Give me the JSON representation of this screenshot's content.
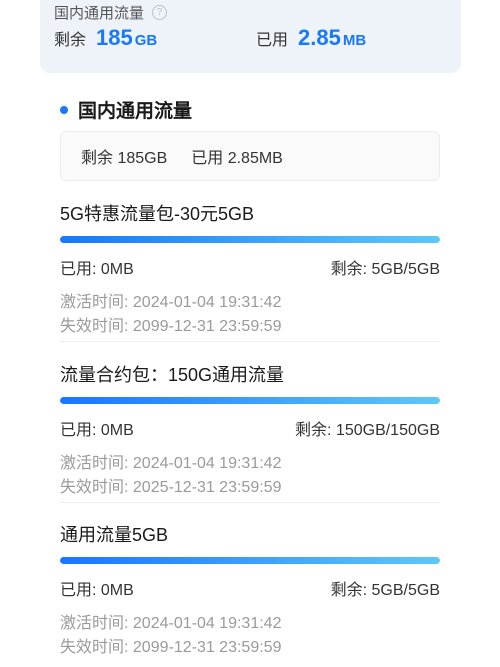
{
  "top_card": {
    "title": "国内通用流量",
    "help_symbol": "?",
    "remaining_label": "剩余",
    "remaining_value": "185",
    "remaining_unit": "GB",
    "used_label": "已用",
    "used_value": "2.85",
    "used_unit": "MB"
  },
  "section": {
    "title": "国内通用流量",
    "summary_remaining": "剩余 185GB",
    "summary_used": "已用 2.85MB"
  },
  "packages": [
    {
      "name": "5G特惠流量包-30元5GB",
      "progress": 1.0,
      "used": "已用: 0MB",
      "remaining": "剩余: 5GB/5GB",
      "activated": "激活时间: 2024-01-04 19:31:42",
      "expires": "失效时间: 2099-12-31 23:59:59"
    },
    {
      "name": "流量合约包：150G通用流量",
      "progress": 1.0,
      "used": "已用: 0MB",
      "remaining": "剩余: 150GB/150GB",
      "activated": "激活时间: 2024-01-04 19:31:42",
      "expires": "失效时间: 2025-12-31 23:59:59"
    },
    {
      "name": "通用流量5GB",
      "progress": 1.0,
      "used": "已用: 0MB",
      "remaining": "剩余: 5GB/5GB",
      "activated": "激活时间: 2024-01-04 19:31:42",
      "expires": "失效时间: 2099-12-31 23:59:59"
    }
  ],
  "colors": {
    "accent": "#1677ff",
    "bar_end": "#5ec8f8"
  }
}
